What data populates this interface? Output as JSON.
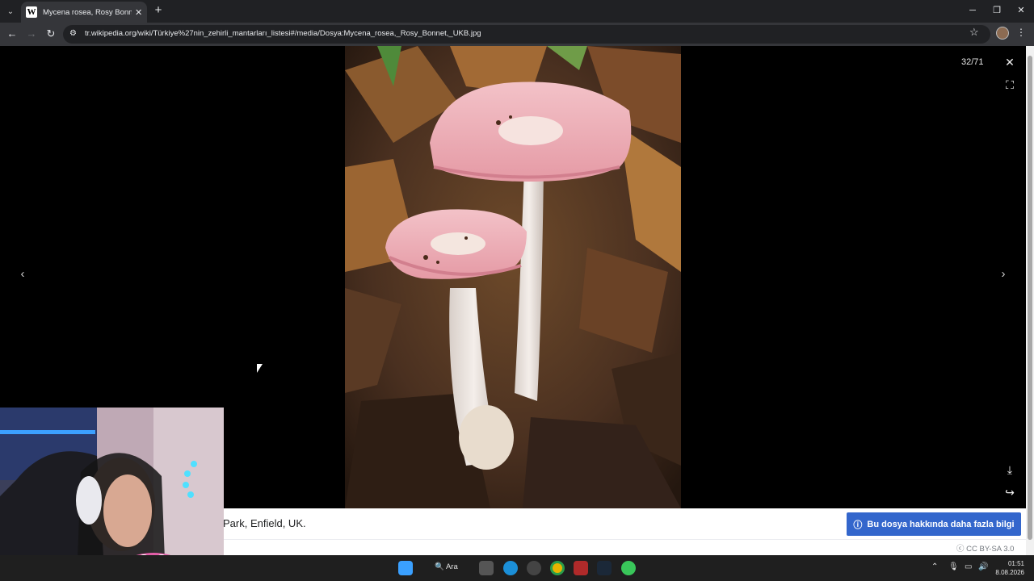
{
  "browser": {
    "tab_title": "Mycena rosea, Rosy Bonnet, UK",
    "tab_favicon": "W",
    "url": "tr.wikipedia.org/wiki/Türkiye%27nin_zehirli_mantarları_listesi#/media/Dosya:Mycena_rosea,_Rosy_Bonnet,_UKB.jpg",
    "icons": {
      "tab_menu": "chevron-down-icon",
      "new_tab": "plus-icon",
      "back": "arrow-left-icon",
      "forward": "arrow-right-icon",
      "reload": "reload-icon",
      "site_info": "tune-icon",
      "bookmark": "star-icon",
      "menu": "kebab-icon"
    }
  },
  "viewer": {
    "counter": "32/71",
    "close_icon": "close-icon",
    "fullscreen_icon": "fullscreen-icon",
    "prev_icon": "chevron-left-icon",
    "next_icon": "chevron-right-icon",
    "download_icon": "download-icon",
    "share_icon": "share-icon",
    "image_subject": "Mycena rosea (Rosy Bonnet) mushrooms among autumn leaves"
  },
  "caption": {
    "text": "Park, Enfield, UK.",
    "more_info_button": "Bu dosya hakkında daha fazla bilgi",
    "license": "CC BY-SA 3.0",
    "accent_color": "#3366cc"
  },
  "taskbar": {
    "search_label": "Ara",
    "time": "01:51",
    "date": "8.08.2026"
  }
}
